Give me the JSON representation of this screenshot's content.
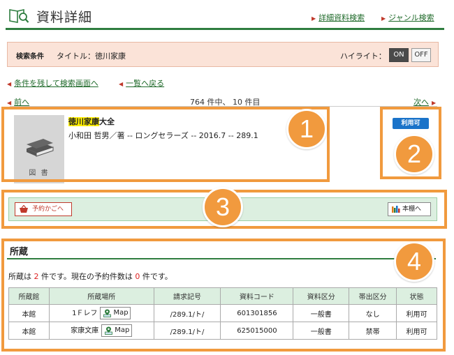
{
  "header": {
    "title": "資料詳細",
    "links": [
      {
        "label": "詳細資料検索"
      },
      {
        "label": "ジャンル検索"
      }
    ]
  },
  "condition": {
    "label": "検索条件",
    "value": "タイトル：徳川家康",
    "highlight_label": "ハイライト：",
    "on": "ON",
    "off": "OFF"
  },
  "nav": {
    "back_search": "条件を残して検索画面へ",
    "back_list": "一覧へ戻る",
    "prev": "前へ",
    "next": "次へ",
    "count": "764 件中、 10 件目"
  },
  "record": {
    "title_highlight": "徳川家康",
    "title_rest": "大全",
    "meta": "小和田 哲男／著 -- ロングセラーズ -- 2016.7 -- 289.1",
    "material_type": "図 書",
    "status": "利用可"
  },
  "actions": {
    "cart": "予約かごへ",
    "shelf": "本棚へ"
  },
  "holdings": {
    "title": "所蔵",
    "summary_pre": "所蔵は ",
    "summary_count": "2",
    "summary_mid": " 件です。現在の予約件数は ",
    "summary_res": "0",
    "summary_post": " 件です。",
    "columns": [
      "所蔵館",
      "所蔵場所",
      "請求記号",
      "資料コード",
      "資料区分",
      "帯出区分",
      "状態"
    ],
    "map_label": "Map",
    "rows": [
      {
        "library": "本館",
        "location": "1Ｆレフ",
        "call": "/289.1/ト/",
        "code": "601301856",
        "category": "一般書",
        "loan": "なし",
        "status": "利用可"
      },
      {
        "library": "本館",
        "location": "家康文庫",
        "call": "/289.1/ト/",
        "code": "625015000",
        "category": "一般書",
        "loan": "禁帯",
        "status": "利用可"
      }
    ]
  },
  "callouts": [
    "1",
    "2",
    "3",
    "4"
  ],
  "colors": {
    "accent": "#f19a3e",
    "brand_green": "#2e7d3f",
    "status_blue": "#1a73c9"
  }
}
